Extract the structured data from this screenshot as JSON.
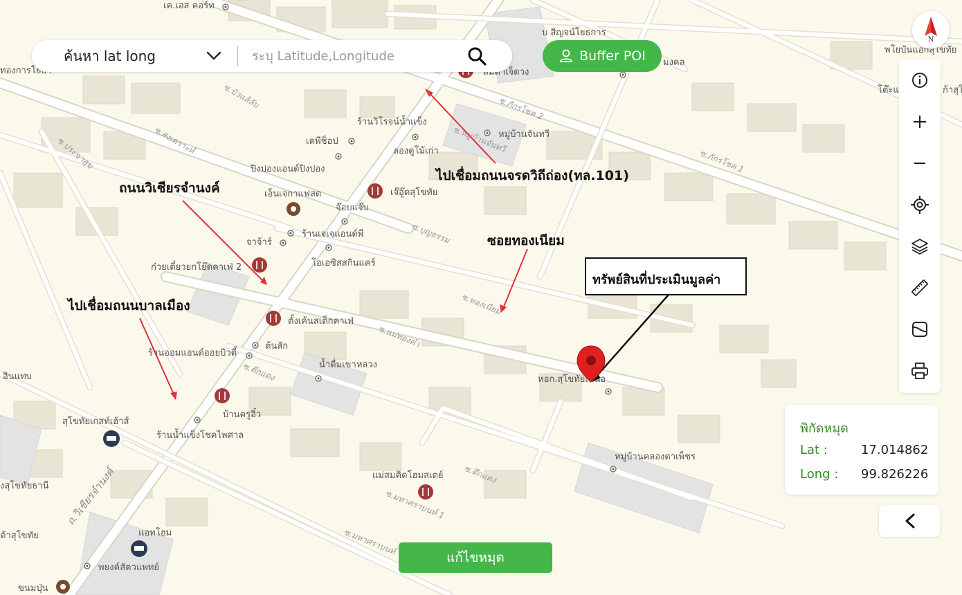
{
  "search": {
    "mode_label": "ค้นหา lat long",
    "placeholder": "ระบุ Latitude,Longitude",
    "value": ""
  },
  "buffer_button": {
    "label": "Buffer POI",
    "icon": "user-icon"
  },
  "compass": {
    "label": "N"
  },
  "toolbar": {
    "tools": [
      "info-icon",
      "zoom-in-icon",
      "zoom-out-icon",
      "locate-icon",
      "layers-icon",
      "ruler-icon",
      "draw-icon",
      "print-icon"
    ]
  },
  "coordinates": {
    "title": "พิกัดหมุด",
    "lat_label": "Lat :",
    "lat_value": "17.014862",
    "long_label": "Long :",
    "long_value": "99.826226"
  },
  "edit_button": {
    "label": "แก้ไขหมุด"
  },
  "annotations": {
    "road_101": "ไปเชื่อมถนนจรดวิถีถ่อง(ทล.101)",
    "wichian_road": "ถนนวิเชียรจำนงค์",
    "soi_thong": "ซอยทองเนียม",
    "asset": "ทรัพย์สินที่ประเมินมูลค่า",
    "banmuang": "ไปเชื่อมถนนบาลเมือง"
  },
  "map_labels": {
    "poi": [
      "เค.เอส คอร์ท",
      "บ สิญจน์โยธการ",
      "สมดาเจ็ดวง",
      "มงคล",
      "พโยบันแอกสุโขทัย",
      "ทองการโยธา",
      "ร้านวิโรจน์น้ำแข็ง",
      "หมู่บ้านจันทวี",
      "เคพีช็อป",
      "ลองดูโม้เก่า",
      "ปิงปองแอนด์ปิงปอง",
      "เจ๊อู๊ดสุโขทัย",
      "เอ็นเจกาแฟสด",
      "จ๊อบแจ๊บ",
      "ร้านเจเจแอนด์พี",
      "จาจ้าร์",
      "ก๋วยเตี๋ยวยกโย๊ดคาเฟ่ 2",
      "โอเอซิสสกินแคร์",
      "ตั้งเค้นสเต็กคาเฟ่",
      "ร้านออมแอนด์ออยบิวตี้",
      "ต้นสัก",
      "น้ำดื่มเขาหลวง",
      "หอก.สุโขทัยเหนือ",
      "บ้านครูอิ๋ว",
      "สุโขทัยเกสท์เฮ้าส์",
      "ร้านน้ำแข็งโชคไพศาล",
      "หมู่บ้านคลองตาเพ็ชร",
      "แม่สมคิดโฮมสเตย์",
      "งสุโขทัยธานี",
      "ต้าสุโขทัย",
      "แอทโฮม",
      "พยงค์สัตวแพทย์",
      "ขนมปุ่น",
      "โต๊ะแ",
      "ก้าสุโข",
      "อินแทบ"
    ],
    "roads": [
      "ซ.บัวแล้ลับ",
      "ซ.สงเคราะห์",
      "ซ.ประชาสุข",
      "ซ.ภักรโชค 2",
      "ซ.หมู่บ้านจันทวี",
      "ซ.ภักรโชค 1",
      "ซ.บุญธรรม",
      "ซ.ทองเนียม",
      "ซ.แม่ทองคำ",
      "ซ.ตึกแดง",
      "ซ.ตึกแดง",
      "ซ.มหาศราบนท์ 1",
      "ซ.มหาศราบนท์",
      "ถ.วิเชียรจำนงค์"
    ]
  }
}
